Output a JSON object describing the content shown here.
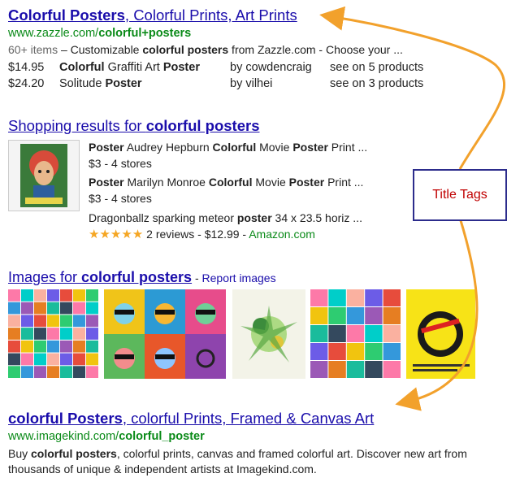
{
  "result1": {
    "title_bold": "Colorful Posters",
    "title_rest": ", Colorful Prints, Art Prints",
    "url_plain": "www.zazzle.com/",
    "url_bold": "colorful+posters",
    "desc_items": "60+ items",
    "desc_dash": " – Customizable ",
    "desc_bold": "colorful posters",
    "desc_rest": " from Zazzle.com - Choose your ...",
    "products": [
      {
        "price": "$14.95",
        "name_html_parts": [
          "Colorful",
          " Graffiti Art ",
          "Poster"
        ],
        "by": "by cowdencraig",
        "see": "see on 5 products"
      },
      {
        "price": "$24.20",
        "name_html_parts": [
          "",
          "Solitude ",
          "Poster"
        ],
        "by": "by vilhei",
        "see": "see on 3 products"
      }
    ]
  },
  "shopping": {
    "heading_plain": "Shopping results for ",
    "heading_bold": "colorful posters",
    "items": [
      {
        "b1": "Poster",
        "t1": " Audrey Hepburn ",
        "b2": "Colorful",
        "t2": " Movie ",
        "b3": "Poster",
        "t3": " Print ...",
        "meta": "$3 - 4 stores"
      },
      {
        "b1": "Poster",
        "t1": " Marilyn Monroe ",
        "b2": "Colorful",
        "t2": " Movie ",
        "b3": "Poster",
        "t3": " Print ...",
        "meta": "$3 - 4 stores"
      },
      {
        "t0": "Dragonballz sparking meteor ",
        "b1": "poster",
        "t1": " 34 x 23.5 horiz ...",
        "stars": "★★★★★",
        "reviews": " 2 reviews - $12.99 - ",
        "store": "Amazon.com"
      }
    ]
  },
  "images": {
    "heading_plain": "Images for ",
    "heading_bold": "colorful posters",
    "dash": " - ",
    "report": "Report images"
  },
  "result2": {
    "title_bold1": "colorful Posters",
    "title_rest": ", colorful Prints, Framed & Canvas Art",
    "url_plain": "www.imagekind.com/",
    "url_bold": "colorful_poster",
    "desc_pre": "Buy ",
    "desc_bold": "colorful posters",
    "desc_rest": ", colorful prints, canvas and framed colorful art. Discover new art from thousands of unique & independent artists at Imagekind.com."
  },
  "annotation": {
    "label": "Title Tags",
    "box_border": "#2c2c8c",
    "text_color": "#c00000",
    "arrow_color": "#f2a12c"
  },
  "colors": {
    "link": "#1a0dab",
    "url_green": "#0a8a18",
    "star": "#f5a623"
  }
}
